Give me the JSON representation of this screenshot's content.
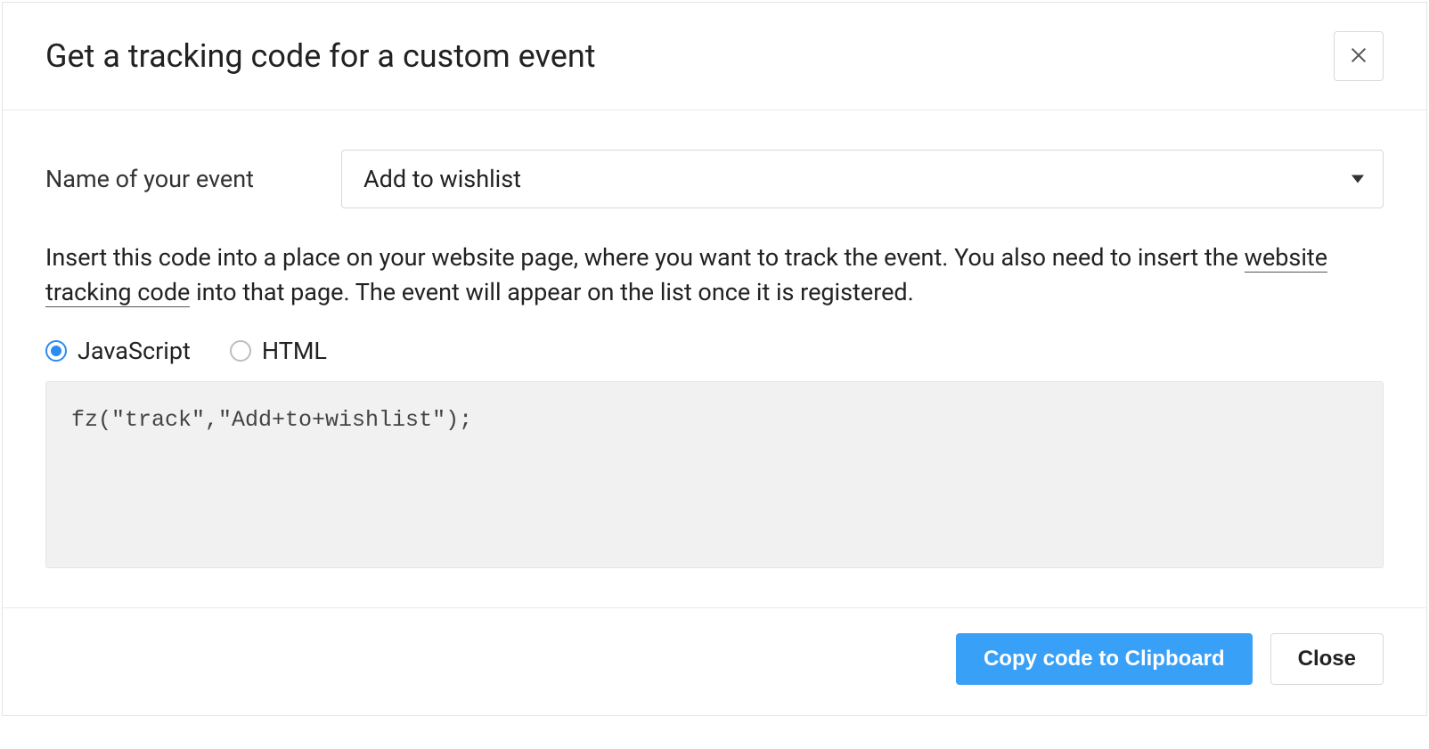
{
  "modal": {
    "title": "Get a tracking code for a custom event",
    "event_name_label": "Name of your event",
    "event_name_value": "Add to wishlist",
    "instruction_pre": "Insert this code into a place on your website page, where you want to track the event. You also need to insert the ",
    "instruction_link": "website tracking code",
    "instruction_post": " into that page. The event will appear on the list once it is registered.",
    "radio": {
      "javascript": "JavaScript",
      "html": "HTML",
      "selected": "javascript"
    },
    "code_snippet": "fz(\"track\",\"Add+to+wishlist\");",
    "footer": {
      "copy_button": "Copy code to Clipboard",
      "close_button": "Close"
    }
  }
}
